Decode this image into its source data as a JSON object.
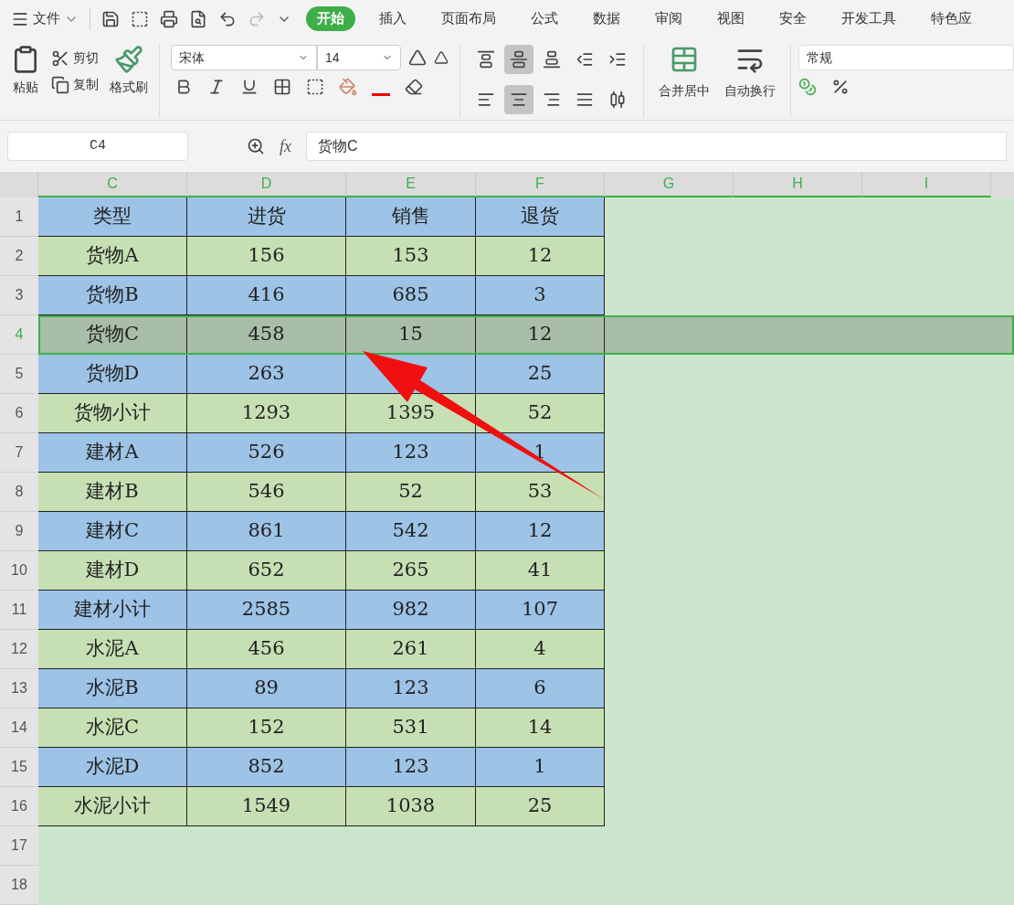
{
  "menu": {
    "file_label": "文件",
    "tabs": [
      {
        "label": "开始",
        "selected": true
      },
      {
        "label": "插入",
        "selected": false
      },
      {
        "label": "页面布局",
        "selected": false
      },
      {
        "label": "公式",
        "selected": false
      },
      {
        "label": "数据",
        "selected": false
      },
      {
        "label": "审阅",
        "selected": false
      },
      {
        "label": "视图",
        "selected": false
      },
      {
        "label": "安全",
        "selected": false
      },
      {
        "label": "开发工具",
        "selected": false
      },
      {
        "label": "特色应",
        "selected": false
      }
    ]
  },
  "clipboard": {
    "paste": "粘贴",
    "cut": "剪切",
    "copy": "复制",
    "format_painter": "格式刷"
  },
  "font": {
    "name": "宋体",
    "size": "14"
  },
  "alignment": [
    {
      "kind": "top",
      "on": false
    },
    {
      "kind": "middle",
      "on": true
    },
    {
      "kind": "bottom",
      "on": false
    },
    {
      "kind": "outdent",
      "on": false
    },
    {
      "kind": "indent",
      "on": false
    },
    {
      "kind": "left",
      "on": false
    },
    {
      "kind": "center",
      "on": true
    },
    {
      "kind": "right",
      "on": false
    },
    {
      "kind": "justify",
      "on": false
    },
    {
      "kind": "distributed",
      "on": false
    }
  ],
  "merge_label": "合并居中",
  "wrap_label": "自动换行",
  "number_format": "常规",
  "formula_bar": {
    "cell_ref": "C4",
    "fx": "fx",
    "content": "货物C"
  },
  "sheet": {
    "columns": [
      {
        "label": "C",
        "selected": true
      },
      {
        "label": "D",
        "selected": true
      },
      {
        "label": "E",
        "selected": true
      },
      {
        "label": "F",
        "selected": true
      },
      {
        "label": "G",
        "selected": true
      },
      {
        "label": "H",
        "selected": true
      },
      {
        "label": "I",
        "selected": true
      }
    ],
    "rows": [
      {
        "label": "1",
        "selected": false,
        "color": "#9dc3e6",
        "cells": [
          "类型",
          "进货",
          "销售",
          "退货"
        ]
      },
      {
        "label": "2",
        "selected": false,
        "color": "#c6e0b4",
        "cells": [
          "货物A",
          "156",
          "153",
          "12"
        ]
      },
      {
        "label": "3",
        "selected": false,
        "color": "#9dc3e6",
        "cells": [
          "货物B",
          "416",
          "685",
          "3"
        ]
      },
      {
        "label": "4",
        "selected": true,
        "color": "#a9bea8",
        "cells": [
          "货物C",
          "458",
          "15",
          "12"
        ]
      },
      {
        "label": "5",
        "selected": false,
        "color": "#9dc3e6",
        "cells": [
          "货物D",
          "263",
          null,
          "25"
        ]
      },
      {
        "label": "6",
        "selected": false,
        "color": "#c6e0b4",
        "cells": [
          "货物小计",
          "1293",
          "1395",
          "52"
        ]
      },
      {
        "label": "7",
        "selected": false,
        "color": "#9dc3e6",
        "cells": [
          "建材A",
          "526",
          "123",
          "1"
        ]
      },
      {
        "label": "8",
        "selected": false,
        "color": "#c6e0b4",
        "cells": [
          "建材B",
          "546",
          "52",
          "53"
        ]
      },
      {
        "label": "9",
        "selected": false,
        "color": "#9dc3e6",
        "cells": [
          "建材C",
          "861",
          "542",
          "12"
        ]
      },
      {
        "label": "10",
        "selected": false,
        "color": "#c6e0b4",
        "cells": [
          "建材D",
          "652",
          "265",
          "41"
        ]
      },
      {
        "label": "11",
        "selected": false,
        "color": "#9dc3e6",
        "cells": [
          "建材小计",
          "2585",
          "982",
          "107"
        ]
      },
      {
        "label": "12",
        "selected": false,
        "color": "#c6e0b4",
        "cells": [
          "水泥A",
          "456",
          "261",
          "4"
        ]
      },
      {
        "label": "13",
        "selected": false,
        "color": "#9dc3e6",
        "cells": [
          "水泥B",
          "89",
          "123",
          "6"
        ]
      },
      {
        "label": "14",
        "selected": false,
        "color": "#c6e0b4",
        "cells": [
          "水泥C",
          "152",
          "531",
          "14"
        ]
      },
      {
        "label": "15",
        "selected": false,
        "color": "#9dc3e6",
        "cells": [
          "水泥D",
          "852",
          "123",
          "1"
        ]
      },
      {
        "label": "16",
        "selected": false,
        "color": "#c6e0b4",
        "cells": [
          "水泥小计",
          "1549",
          "1038",
          "25"
        ]
      },
      {
        "label": "17",
        "selected": false,
        "color": null,
        "cells": []
      },
      {
        "label": "18",
        "selected": false,
        "color": null,
        "cells": []
      }
    ]
  }
}
